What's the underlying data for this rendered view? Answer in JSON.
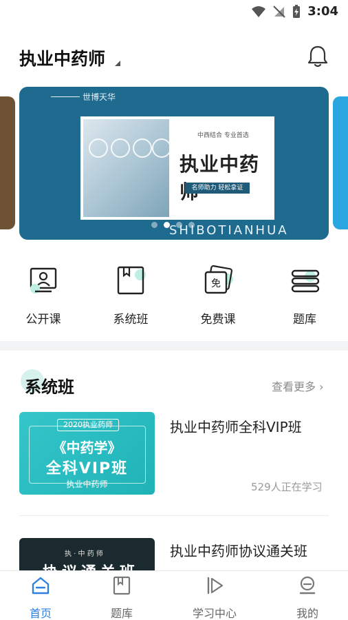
{
  "status_bar": {
    "time": "3:04"
  },
  "header": {
    "title": "执业中药师"
  },
  "banner": {
    "brand": "世博天华",
    "tagline": "中西结合 专业首选",
    "main_title": "执业中药师",
    "slogan": "名师助力 轻松拿证",
    "latin": "SHIBOTIANHUA",
    "slide_count": 4,
    "active_slide": 2
  },
  "categories": [
    {
      "label": "公开课",
      "icon": "open-class-icon"
    },
    {
      "label": "系统班",
      "icon": "system-class-icon"
    },
    {
      "label": "免费课",
      "icon": "free-class-icon"
    },
    {
      "label": "题库",
      "icon": "question-bank-icon"
    }
  ],
  "section": {
    "title": "系统班",
    "see_more": "查看更多"
  },
  "courses": [
    {
      "name": "执业中药师全科VIP班",
      "count": "529人正在学习",
      "thumb": {
        "tag": "2020执业药师",
        "line1": "《中药学》",
        "line2": "全科VIP班",
        "foot": "执业中药师"
      }
    },
    {
      "name": "执业中药师协议通关班",
      "thumb": {
        "small": "执 · 中 药 师",
        "big": "协议通关班"
      }
    }
  ],
  "bottom_nav": [
    {
      "label": "首页",
      "icon": "home-icon",
      "active": true
    },
    {
      "label": "题库",
      "icon": "bookmark-book-icon",
      "active": false
    },
    {
      "label": "学习中心",
      "icon": "play-next-icon",
      "active": false
    },
    {
      "label": "我的",
      "icon": "profile-icon",
      "active": false
    }
  ],
  "colors": {
    "accent": "#2d7fe0",
    "banner_bg": "#1f6a8f",
    "mint": "#bfeee3"
  }
}
